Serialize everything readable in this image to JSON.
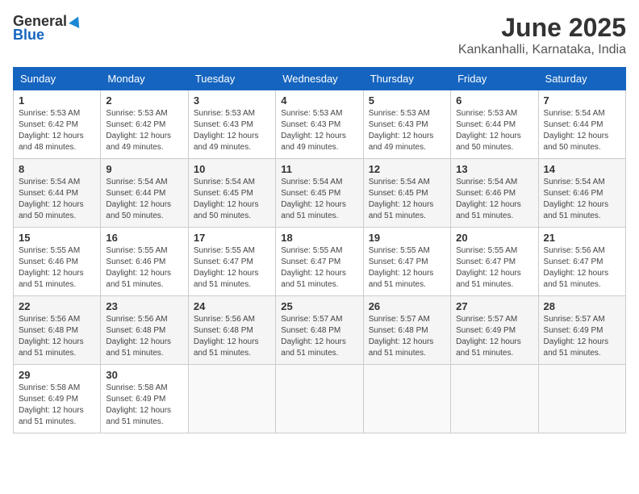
{
  "header": {
    "logo_general": "General",
    "logo_blue": "Blue",
    "month_title": "June 2025",
    "location": "Kankanhalli, Karnataka, India"
  },
  "weekdays": [
    "Sunday",
    "Monday",
    "Tuesday",
    "Wednesday",
    "Thursday",
    "Friday",
    "Saturday"
  ],
  "weeks": [
    [
      {
        "day": "1",
        "info": "Sunrise: 5:53 AM\nSunset: 6:42 PM\nDaylight: 12 hours\nand 48 minutes."
      },
      {
        "day": "2",
        "info": "Sunrise: 5:53 AM\nSunset: 6:42 PM\nDaylight: 12 hours\nand 49 minutes."
      },
      {
        "day": "3",
        "info": "Sunrise: 5:53 AM\nSunset: 6:43 PM\nDaylight: 12 hours\nand 49 minutes."
      },
      {
        "day": "4",
        "info": "Sunrise: 5:53 AM\nSunset: 6:43 PM\nDaylight: 12 hours\nand 49 minutes."
      },
      {
        "day": "5",
        "info": "Sunrise: 5:53 AM\nSunset: 6:43 PM\nDaylight: 12 hours\nand 49 minutes."
      },
      {
        "day": "6",
        "info": "Sunrise: 5:53 AM\nSunset: 6:44 PM\nDaylight: 12 hours\nand 50 minutes."
      },
      {
        "day": "7",
        "info": "Sunrise: 5:54 AM\nSunset: 6:44 PM\nDaylight: 12 hours\nand 50 minutes."
      }
    ],
    [
      {
        "day": "8",
        "info": "Sunrise: 5:54 AM\nSunset: 6:44 PM\nDaylight: 12 hours\nand 50 minutes."
      },
      {
        "day": "9",
        "info": "Sunrise: 5:54 AM\nSunset: 6:44 PM\nDaylight: 12 hours\nand 50 minutes."
      },
      {
        "day": "10",
        "info": "Sunrise: 5:54 AM\nSunset: 6:45 PM\nDaylight: 12 hours\nand 50 minutes."
      },
      {
        "day": "11",
        "info": "Sunrise: 5:54 AM\nSunset: 6:45 PM\nDaylight: 12 hours\nand 51 minutes."
      },
      {
        "day": "12",
        "info": "Sunrise: 5:54 AM\nSunset: 6:45 PM\nDaylight: 12 hours\nand 51 minutes."
      },
      {
        "day": "13",
        "info": "Sunrise: 5:54 AM\nSunset: 6:46 PM\nDaylight: 12 hours\nand 51 minutes."
      },
      {
        "day": "14",
        "info": "Sunrise: 5:54 AM\nSunset: 6:46 PM\nDaylight: 12 hours\nand 51 minutes."
      }
    ],
    [
      {
        "day": "15",
        "info": "Sunrise: 5:55 AM\nSunset: 6:46 PM\nDaylight: 12 hours\nand 51 minutes."
      },
      {
        "day": "16",
        "info": "Sunrise: 5:55 AM\nSunset: 6:46 PM\nDaylight: 12 hours\nand 51 minutes."
      },
      {
        "day": "17",
        "info": "Sunrise: 5:55 AM\nSunset: 6:47 PM\nDaylight: 12 hours\nand 51 minutes."
      },
      {
        "day": "18",
        "info": "Sunrise: 5:55 AM\nSunset: 6:47 PM\nDaylight: 12 hours\nand 51 minutes."
      },
      {
        "day": "19",
        "info": "Sunrise: 5:55 AM\nSunset: 6:47 PM\nDaylight: 12 hours\nand 51 minutes."
      },
      {
        "day": "20",
        "info": "Sunrise: 5:55 AM\nSunset: 6:47 PM\nDaylight: 12 hours\nand 51 minutes."
      },
      {
        "day": "21",
        "info": "Sunrise: 5:56 AM\nSunset: 6:47 PM\nDaylight: 12 hours\nand 51 minutes."
      }
    ],
    [
      {
        "day": "22",
        "info": "Sunrise: 5:56 AM\nSunset: 6:48 PM\nDaylight: 12 hours\nand 51 minutes."
      },
      {
        "day": "23",
        "info": "Sunrise: 5:56 AM\nSunset: 6:48 PM\nDaylight: 12 hours\nand 51 minutes."
      },
      {
        "day": "24",
        "info": "Sunrise: 5:56 AM\nSunset: 6:48 PM\nDaylight: 12 hours\nand 51 minutes."
      },
      {
        "day": "25",
        "info": "Sunrise: 5:57 AM\nSunset: 6:48 PM\nDaylight: 12 hours\nand 51 minutes."
      },
      {
        "day": "26",
        "info": "Sunrise: 5:57 AM\nSunset: 6:48 PM\nDaylight: 12 hours\nand 51 minutes."
      },
      {
        "day": "27",
        "info": "Sunrise: 5:57 AM\nSunset: 6:49 PM\nDaylight: 12 hours\nand 51 minutes."
      },
      {
        "day": "28",
        "info": "Sunrise: 5:57 AM\nSunset: 6:49 PM\nDaylight: 12 hours\nand 51 minutes."
      }
    ],
    [
      {
        "day": "29",
        "info": "Sunrise: 5:58 AM\nSunset: 6:49 PM\nDaylight: 12 hours\nand 51 minutes."
      },
      {
        "day": "30",
        "info": "Sunrise: 5:58 AM\nSunset: 6:49 PM\nDaylight: 12 hours\nand 51 minutes."
      },
      {
        "day": "",
        "info": ""
      },
      {
        "day": "",
        "info": ""
      },
      {
        "day": "",
        "info": ""
      },
      {
        "day": "",
        "info": ""
      },
      {
        "day": "",
        "info": ""
      }
    ]
  ]
}
